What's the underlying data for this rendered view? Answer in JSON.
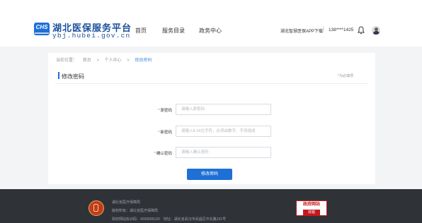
{
  "header": {
    "logo_text": "CHS",
    "site_title": "湖北医保服务平台",
    "site_url": "ybj.hubei.gov.cn",
    "nav": [
      "首页",
      "服务目录",
      "政务中心"
    ],
    "app_download": "湖北智慧医保APP下载",
    "separator": "|",
    "phone": "138****1425",
    "icons": {
      "notification": "bell-icon",
      "user": "avatar"
    }
  },
  "breadcrumb": {
    "prefix": "当前位置：",
    "items": [
      "首页",
      "个人中心",
      "修改密码"
    ],
    "separator": ">"
  },
  "section": {
    "title": "修改密码",
    "required_note": "*为必填项"
  },
  "form": {
    "fields": [
      {
        "label": "原密码",
        "placeholder": "请输入原密码",
        "value": ""
      },
      {
        "label": "新密码",
        "placeholder": "请输入8-16位字符，必须由数字、字母组成",
        "value": ""
      },
      {
        "label": "确认密码",
        "placeholder": "请输入确认密码",
        "value": ""
      }
    ],
    "required_mark": "*",
    "submit_label": "修改密码"
  },
  "footer": {
    "line1": "湖北省医疗保障局",
    "line2": "版权所有：湖北省医疗保障局",
    "line3": "政府网站标识码：4200000120　地址：湖北省武汉市武昌区中北路101号",
    "gov_badge_top": "政府网站",
    "gov_badge_bottom": "找错"
  },
  "colors": {
    "primary": "#1e6fd6",
    "required": "#e34b4b",
    "footer_bg": "#2f3338",
    "page_bg": "#f3f4f6"
  }
}
